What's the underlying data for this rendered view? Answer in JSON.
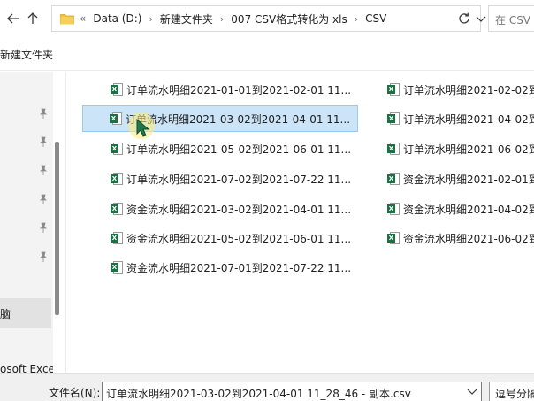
{
  "address": {
    "crumbs": [
      "«",
      "Data (D:)",
      "新建文件夹",
      "007 CSV格式转化为 xls",
      "CSV"
    ],
    "search_placeholder": "在 CSV 中"
  },
  "toolbar": {
    "new_folder_label": "新建文件夹"
  },
  "nav": {
    "selected_label": "脑",
    "bottom_label": "osoft Excel"
  },
  "files": {
    "col1": [
      "订单流水明细2021-01-01到2021-02-01 11...",
      "订单流水明细2021-03-02到2021-04-01 11...",
      "订单流水明细2021-05-02到2021-06-01 11...",
      "订单流水明细2021-07-02到2021-07-22 11...",
      "资金流水明细2021-03-02到2021-04-01 11...",
      "资金流水明细2021-05-02到2021-06-01 11...",
      "资金流水明细2021-07-01到2021-07-22 11..."
    ],
    "col2": [
      "订单流水明细2021-02-02到",
      "订单流水明细2021-04-02到",
      "订单流水明细2021-06-02到",
      "资金流水明细2021-02-01到",
      "资金流水明细2021-04-02到",
      "资金流水明细2021-06-02到"
    ],
    "selected_index": 1,
    "icon_badge": "X"
  },
  "bottom": {
    "filename_label": "文件名(N):",
    "filename_value": "订单流水明细2021-03-02到2021-04-01 11_28_46 - 副本.csv",
    "filter_label": "逗号分隔"
  },
  "colors": {
    "selection": "#cce4f7",
    "excel_green": "#1d7044"
  }
}
